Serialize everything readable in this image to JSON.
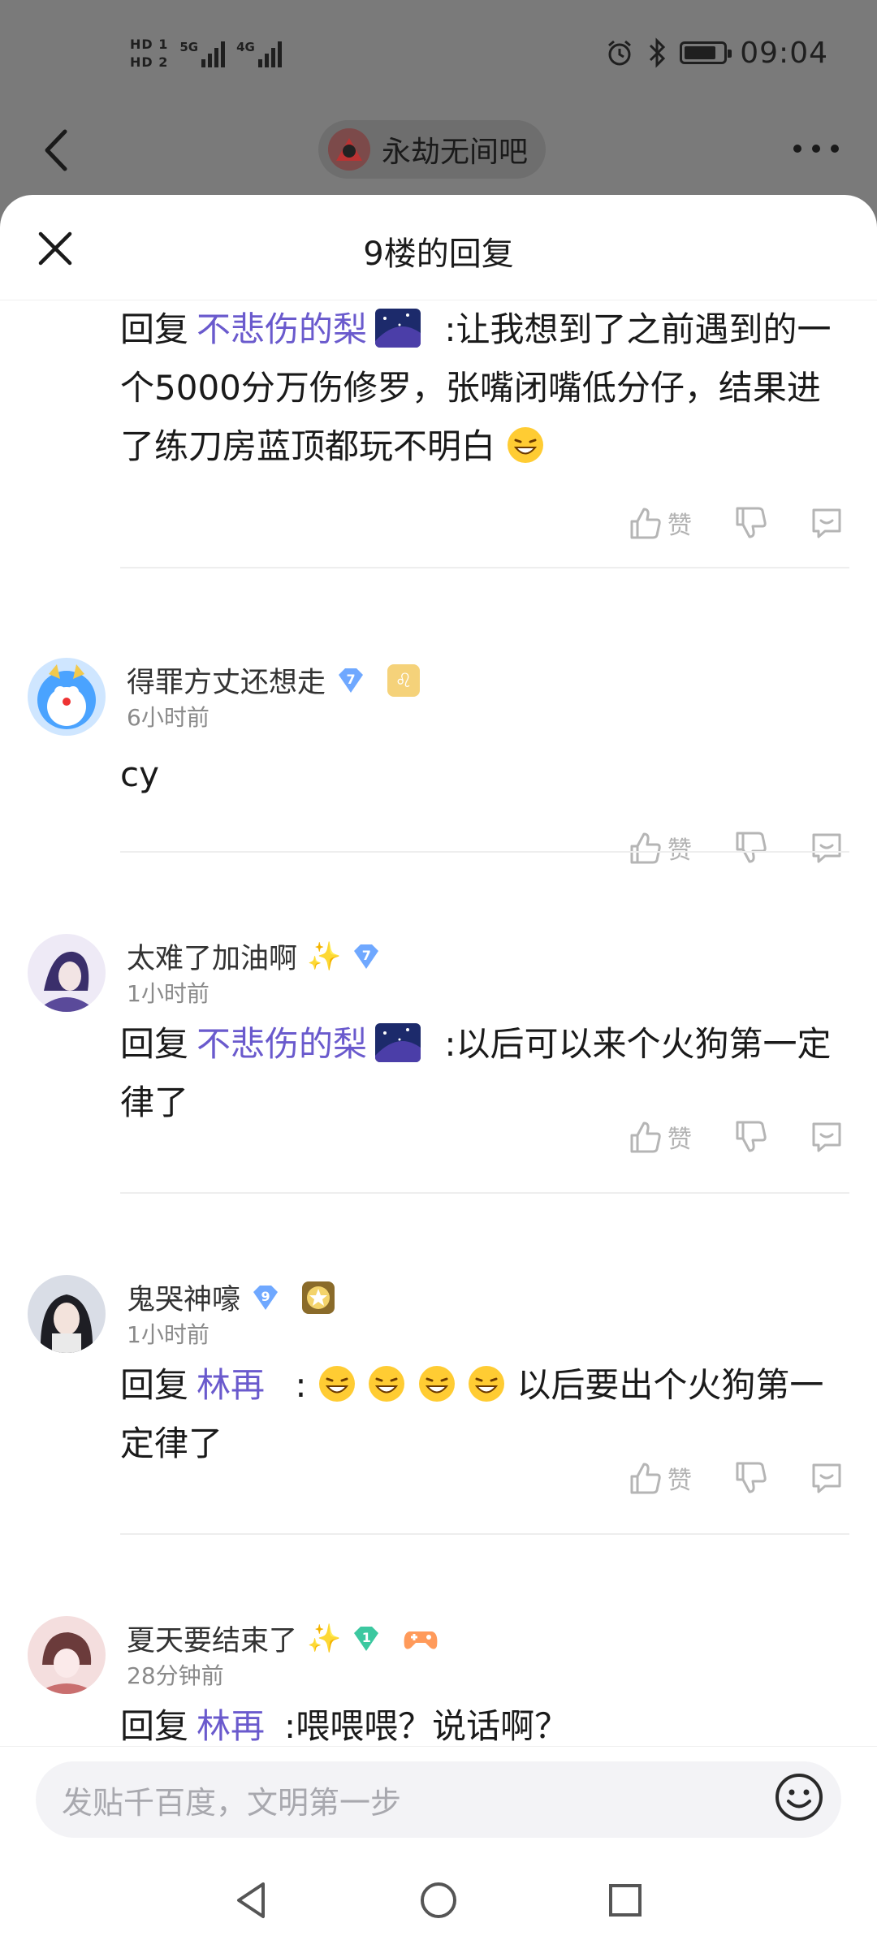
{
  "status_bar": {
    "hd1": "HD 1",
    "hd2": "HD 2",
    "net1": "5G",
    "net2": "4G",
    "time": "09:04"
  },
  "top_nav": {
    "forum_name": "永劫无间吧"
  },
  "sheet": {
    "title": "9楼的回复"
  },
  "comments": [
    {
      "reply_prefix": "回复",
      "reply_to": "不悲伤的梨",
      "text": ":让我想到了之前遇到的一个5000分万伤修罗，张嘴闭嘴低分仔，结果进了练刀房蓝顶都玩不明白",
      "like_label": "赞"
    },
    {
      "user": "得罪方丈还想走",
      "level": "7",
      "time": "6小时前",
      "text": "cy",
      "like_label": "赞"
    },
    {
      "user": "太难了加油啊",
      "level": "7",
      "time": "1小时前",
      "reply_prefix": "回复",
      "reply_to": "不悲伤的梨",
      "text": ":以后可以来个火狗第一定律了",
      "like_label": "赞"
    },
    {
      "user": "鬼哭神嚎",
      "level": "9",
      "time": "1小时前",
      "reply_prefix": "回复",
      "reply_to": "林再",
      "text_prefix": ":",
      "text": "以后要出个火狗第一定律了",
      "like_label": "赞"
    },
    {
      "user": "夏天要结束了",
      "level": "1",
      "time": "28分钟前",
      "reply_prefix": "回复",
      "reply_to": "林再",
      "text": ":喂喂喂？说话啊？"
    }
  ],
  "input": {
    "placeholder": "发贴千百度，文明第一步"
  },
  "colors": {
    "reply_user": "#6a5acd",
    "badge_blue": "#6fa8ff",
    "badge_green": "#3cc8a0",
    "dim_overlay": "#7a7a7a"
  }
}
